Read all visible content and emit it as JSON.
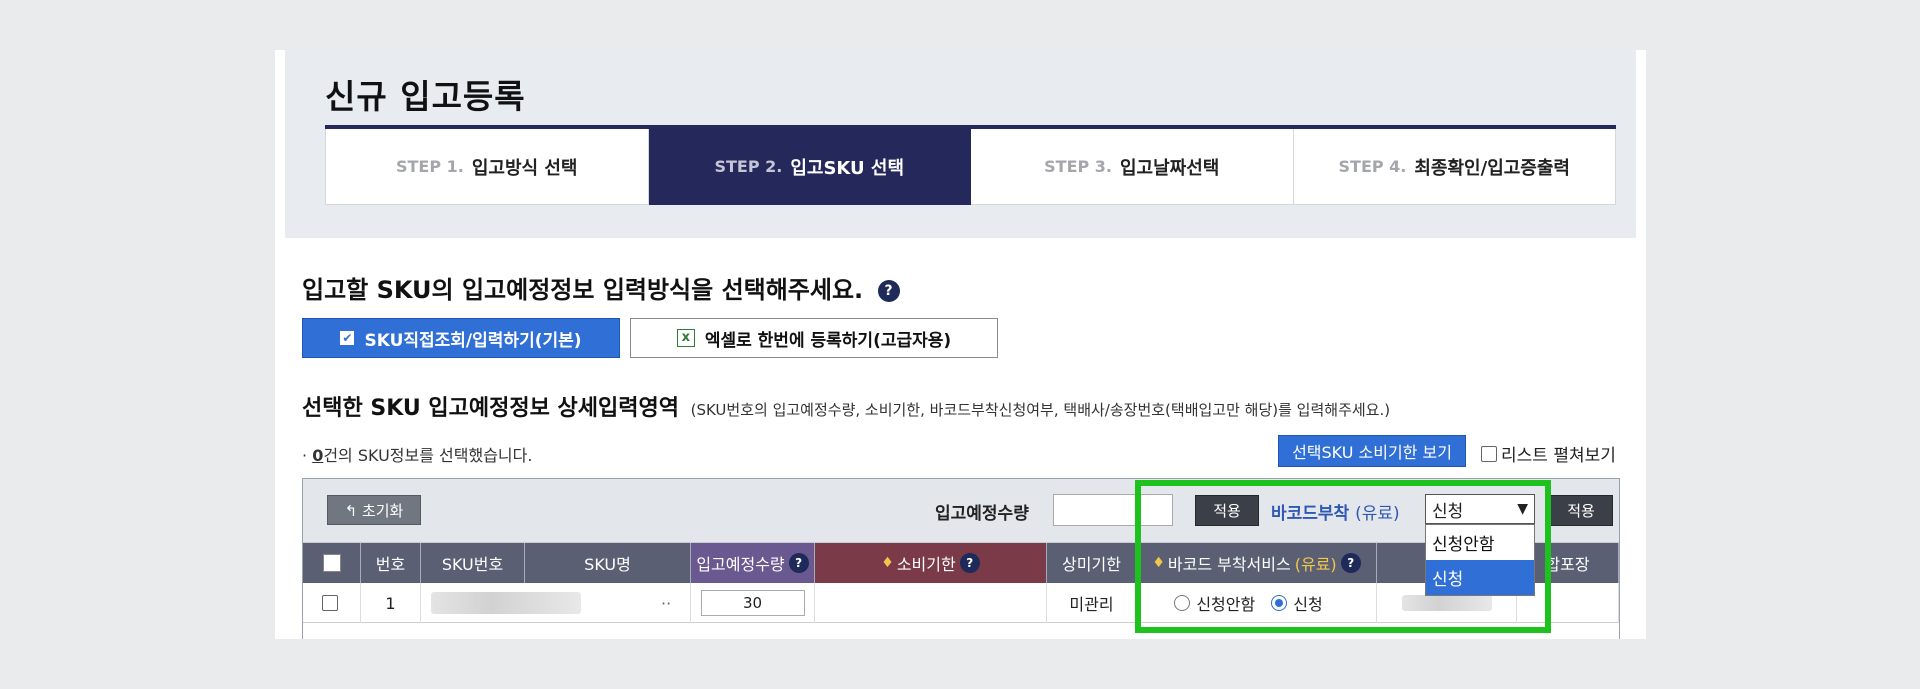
{
  "page_title": "신규 입고등록",
  "steps": [
    {
      "num": "STEP 1.",
      "label": "입고방식 선택"
    },
    {
      "num": "STEP 2.",
      "label": "입고SKU 선택"
    },
    {
      "num": "STEP 3.",
      "label": "입고날짜선택"
    },
    {
      "num": "STEP 4.",
      "label": "최종확인/입고증출력"
    }
  ],
  "active_step": 2,
  "section_title": "입고할 SKU의 입고예정정보 입력방식을 선택해주세요.",
  "help_symbol": "?",
  "mode_buttons": {
    "direct": "SKU직접조회/입력하기(기본)",
    "excel": "엑셀로 한번에 등록하기(고급자용)"
  },
  "detail": {
    "title": "선택한 SKU 입고예정정보 상세입력영역",
    "note": "(SKU번호의 입고예정수량, 소비기한, 바코드부착신청여부, 택배사/송장번호(택배입고만 해당)를 입력해주세요.)"
  },
  "selection": {
    "prefix": "·",
    "count": "0",
    "suffix": "건의 SKU정보를 선택했습니다."
  },
  "view_expiry_button": "선택SKU 소비기한 보기",
  "spread_view_label": "리스트 펼쳐보기",
  "toolbar": {
    "reset_label": "↰ 초기화",
    "qty_label": "입고예정수량",
    "apply_label": "적용",
    "barcode_label": "바코드부착",
    "barcode_paid": "(유료)",
    "barcode_selected": "신청",
    "barcode_options": [
      "신청안함",
      "신청"
    ]
  },
  "columns": {
    "no": "번호",
    "sku_no": "SKU번호",
    "sku_name": "SKU명",
    "qty": "입고예정수량",
    "expiry": "소비기한",
    "use_by": "상미기한",
    "barcode_service": "바코드 부착서비스",
    "barcode_service_paid": "(유료)",
    "combined_pack": "합포장"
  },
  "row": {
    "no": "1",
    "sku_name_suffix": "··",
    "qty": "30",
    "use_by": "미관리",
    "radio_no": "신청안함",
    "radio_yes": "신청",
    "radio_selected": "신청"
  },
  "colors": {
    "navy": "#24285a",
    "primary_blue": "#2f6fd6",
    "highlight_green": "#1ec21e"
  }
}
